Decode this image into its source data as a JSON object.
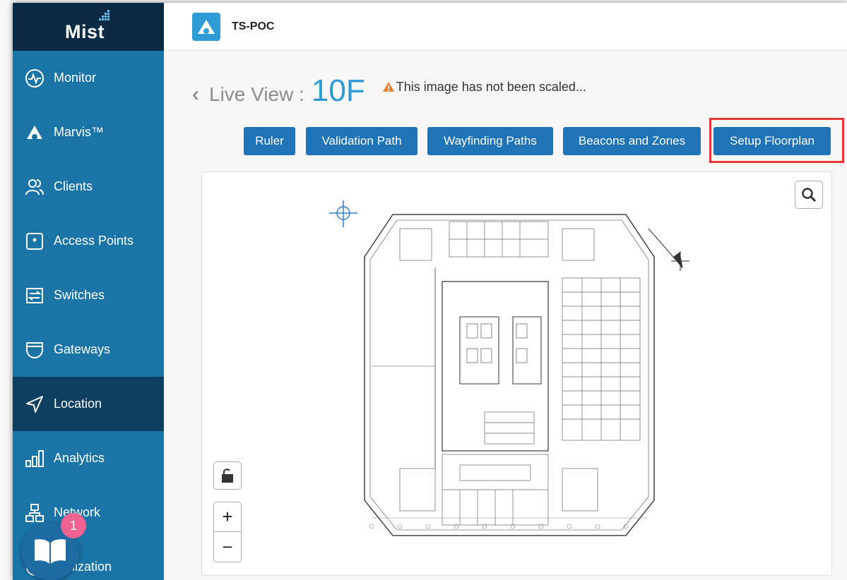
{
  "app": {
    "brand": "Mist",
    "site_name": "TS-POC",
    "colors": {
      "sidebar": "#1a74a6",
      "sidebar_dark": "#0b2b44",
      "active_item": "#0d3f61",
      "button": "#1f73b7",
      "accent": "#2d99d5",
      "highlight": "#e53935"
    }
  },
  "sidebar": {
    "items": [
      {
        "label": "Monitor",
        "icon": "monitor-icon"
      },
      {
        "label": "Marvis™",
        "icon": "marvis-icon"
      },
      {
        "label": "Clients",
        "icon": "clients-icon"
      },
      {
        "label": "Access Points",
        "icon": "access-point-icon"
      },
      {
        "label": "Switches",
        "icon": "switch-icon"
      },
      {
        "label": "Gateways",
        "icon": "gateway-icon"
      },
      {
        "label": "Location",
        "icon": "location-arrow-icon",
        "active": true
      },
      {
        "label": "Analytics",
        "icon": "analytics-icon"
      },
      {
        "label": "Network",
        "icon": "network-icon"
      },
      {
        "label": "ganization",
        "icon": "globe-icon"
      }
    ]
  },
  "page": {
    "live_label": "Live View :",
    "floor_name": "10F",
    "warning": "This image has not been scaled..."
  },
  "toolbar": {
    "buttons": [
      "Ruler",
      "Validation Path",
      "Wayfinding Paths",
      "Beacons and Zones",
      "Setup Floorplan"
    ]
  },
  "map": {
    "zoom_in": "+",
    "zoom_out": "−"
  },
  "help": {
    "badge_count": "1"
  }
}
